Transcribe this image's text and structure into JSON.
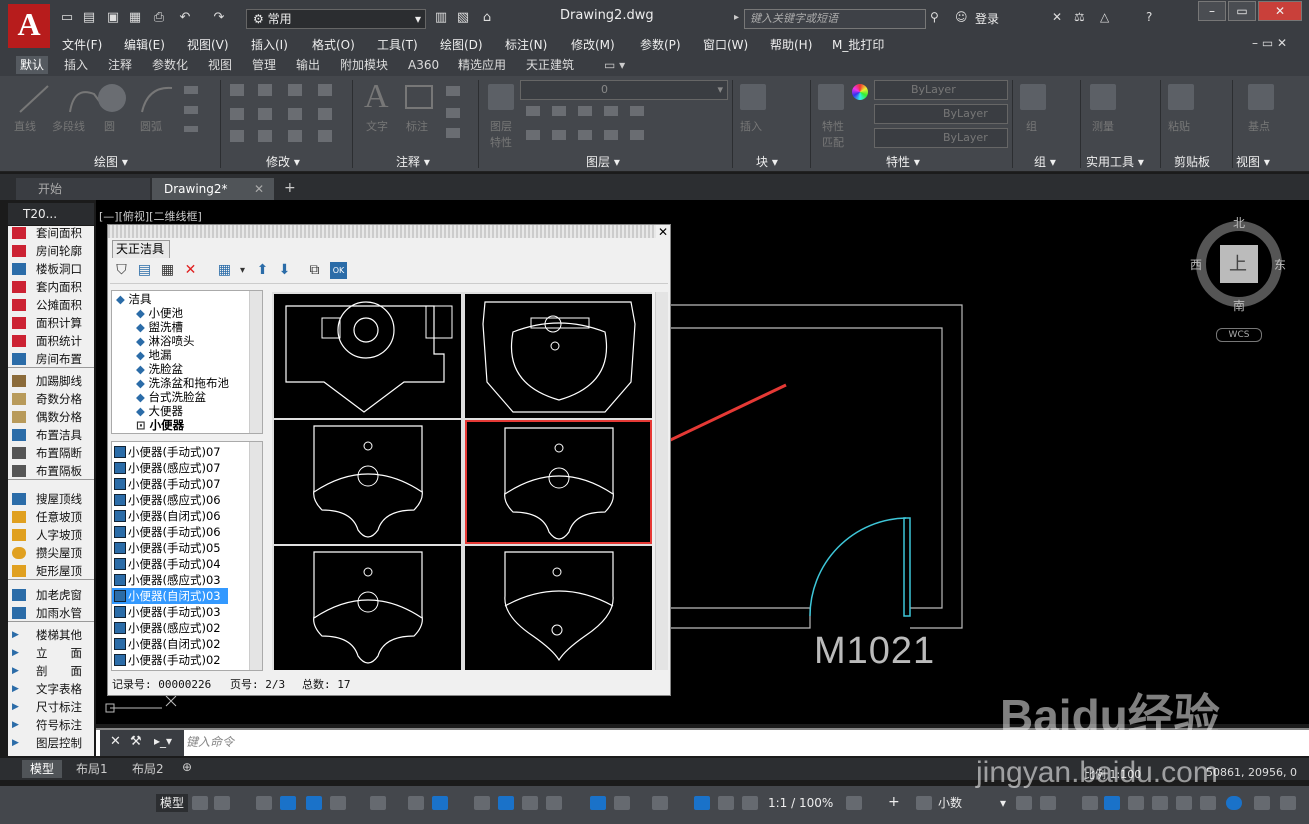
{
  "app": {
    "logo_text": "A",
    "doc_title": "Drawing2.dwg",
    "workspace": "常用",
    "search_placeholder": "键入关键字或短语",
    "login": "登录"
  },
  "menu": [
    "文件(F)",
    "编辑(E)",
    "视图(V)",
    "插入(I)",
    "格式(O)",
    "工具(T)",
    "绘图(D)",
    "标注(N)",
    "修改(M)",
    "参数(P)",
    "窗口(W)",
    "帮助(H)",
    "M_批打印"
  ],
  "ribbon_tabs": [
    "默认",
    "插入",
    "注释",
    "参数化",
    "视图",
    "管理",
    "输出",
    "附加模块",
    "A360",
    "精选应用",
    "天正建筑"
  ],
  "ribbon": {
    "draw_tools": [
      "直线",
      "多段线",
      "圆",
      "圆弧"
    ],
    "modify_label": "修改",
    "annotation_tools": [
      "文字",
      "标注"
    ],
    "layer_tools": [
      "图层特性"
    ],
    "layer_current": "0",
    "block_tools": [
      "插入"
    ],
    "prop_tools": [
      "特性匹配"
    ],
    "bylayer": [
      "ByLayer",
      "ByLayer",
      "ByLayer"
    ],
    "group_tools": [
      "组"
    ],
    "util_tools": [
      "测量"
    ],
    "clip_tools": [
      "粘贴"
    ],
    "view_tools": [
      "基点"
    ],
    "panels": [
      "绘图 ▾",
      "修改 ▾",
      "注释 ▾",
      "图层 ▾",
      "块 ▾",
      "特性 ▾",
      "组 ▾",
      "实用工具 ▾",
      "剪贴板",
      "视图 ▾"
    ]
  },
  "file_tabs": [
    "开始",
    "Drawing2*"
  ],
  "view_label": "[—][俯视][二维线框]",
  "palette": {
    "title": "T20...",
    "items": [
      "套间面积",
      "房间轮廓",
      "楼板洞口",
      "套内面积",
      "公摊面积",
      "面积计算",
      "面积统计",
      "房间布置",
      "加踢脚线",
      "奇数分格",
      "偶数分格",
      "布置洁具",
      "布置隔断",
      "布置隔板",
      "搜屋顶线",
      "任意坡顶",
      "人字坡顶",
      "攒尖屋顶",
      "矩形屋顶",
      "加老虎窗",
      "加雨水管",
      "楼梯其他",
      "立　　面",
      "剖　　面",
      "文字表格",
      "尺寸标注",
      "符号标注",
      "图层控制"
    ]
  },
  "dialog": {
    "title": "天正洁具",
    "tree_root": "洁具",
    "tree_items": [
      "小便池",
      "盥洗槽",
      "淋浴喷头",
      "地漏",
      "洗脸盆",
      "洗涤盆和拖布池",
      "台式洗脸盆",
      "大便器",
      "小便器"
    ],
    "list_items": [
      "小便器(手动式)07",
      "小便器(感应式)07",
      "小便器(手动式)07",
      "小便器(感应式)06",
      "小便器(自闭式)06",
      "小便器(手动式)06",
      "小便器(手动式)05",
      "小便器(手动式)04",
      "小便器(感应式)03",
      "小便器(自闭式)03",
      "小便器(手动式)03",
      "小便器(感应式)02",
      "小便器(自闭式)02",
      "小便器(手动式)02"
    ],
    "selected_index": 9,
    "status": {
      "record": "记录号: 00000226",
      "page": "页号: 2/3",
      "total": "总数:  17"
    }
  },
  "drawing": {
    "door_tag": "M1021",
    "compass": {
      "north": "北",
      "south": "南",
      "east": "东",
      "west": "西",
      "center": "上",
      "wcs": "WCS"
    }
  },
  "command": {
    "placeholder": "键入命令"
  },
  "layout_tabs": [
    "模型",
    "布局1",
    "布局2"
  ],
  "status": {
    "model": "模型",
    "scale": "1:1 / 100%",
    "units": "小数",
    "coords": "50861, 20956, 0",
    "scale_label": "比例 1:100"
  },
  "watermark": "Baidu经验",
  "watermark_url": "jingyan.baidu.com"
}
